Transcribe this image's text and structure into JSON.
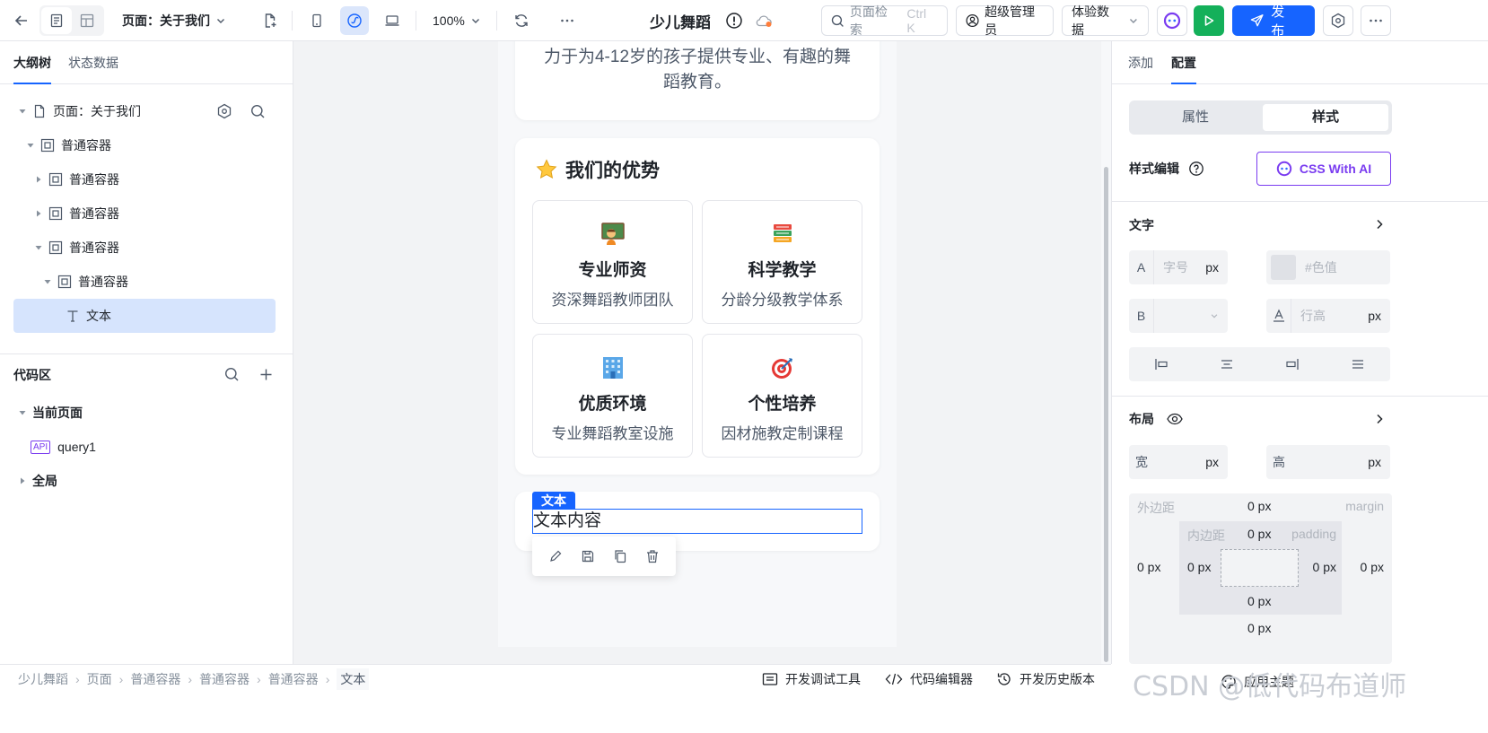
{
  "header": {
    "page_selector": "页面：关于我们",
    "zoom": "100%",
    "app_title": "少儿舞蹈",
    "search_label": "页面检索",
    "search_shortcut": "Ctrl K",
    "user_role": "超级管理员",
    "data_mode": "体验数据",
    "publish_label": "发布"
  },
  "left": {
    "tabs": [
      "大纲树",
      "状态数据"
    ],
    "tree": [
      {
        "label": "页面：关于我们",
        "kind": "page"
      },
      {
        "label": "普通容器",
        "kind": "container"
      },
      {
        "label": "普通容器",
        "kind": "container"
      },
      {
        "label": "普通容器",
        "kind": "container"
      },
      {
        "label": "普通容器",
        "kind": "container"
      },
      {
        "label": "普通容器",
        "kind": "container"
      },
      {
        "label": "文本",
        "kind": "text"
      }
    ],
    "code": {
      "title": "代码区",
      "current_page": "当前页面",
      "query": "query1",
      "api_badge": "API",
      "global": "全局"
    }
  },
  "canvas": {
    "intro_text": "力于为4-12岁的孩子提供专业、有趣的舞蹈教育。",
    "advantages_title": "我们的优势",
    "features": [
      {
        "title": "专业师资",
        "desc": "资深舞蹈教师团队",
        "icon": "teacher-icon"
      },
      {
        "title": "科学教学",
        "desc": "分龄分级教学体系",
        "icon": "books-icon"
      },
      {
        "title": "优质环境",
        "desc": "专业舞蹈教室设施",
        "icon": "building-icon"
      },
      {
        "title": "个性培养",
        "desc": "因材施教定制课程",
        "icon": "target-icon"
      }
    ],
    "selected_label": "文本",
    "selected_text": "文本内容"
  },
  "right": {
    "tabs": [
      "添加",
      "配置"
    ],
    "seg": [
      "属性",
      "样式"
    ],
    "style_edit": "样式编辑",
    "css_ai": "CSS With AI",
    "text_section": "文字",
    "font_size_ph": "字号",
    "color_ph": "#色值",
    "line_height_ph": "行高",
    "unit": "px",
    "layout_section": "布局",
    "width_label": "宽",
    "height_label": "高",
    "margin_label": "外边距",
    "margin_en": "margin",
    "padding_label": "内边距",
    "padding_en": "padding",
    "zero_px": "0 px",
    "font_prefix_a": "A",
    "font_prefix_b": "B"
  },
  "footer": {
    "breadcrumb": [
      "少儿舞蹈",
      "页面",
      "普通容器",
      "普通容器",
      "普通容器",
      "文本"
    ],
    "dev_tools": "开发调试工具",
    "code_editor": "代码编辑器",
    "history": "开发历史版本",
    "apply_theme": "应用主题",
    "watermark": "CSDN @低代码布道师"
  },
  "colors": {
    "accent": "#1664ff",
    "green": "#14b05a",
    "selected_bg": "#d6e4fd",
    "ai_purple": "#7a3cf0"
  }
}
